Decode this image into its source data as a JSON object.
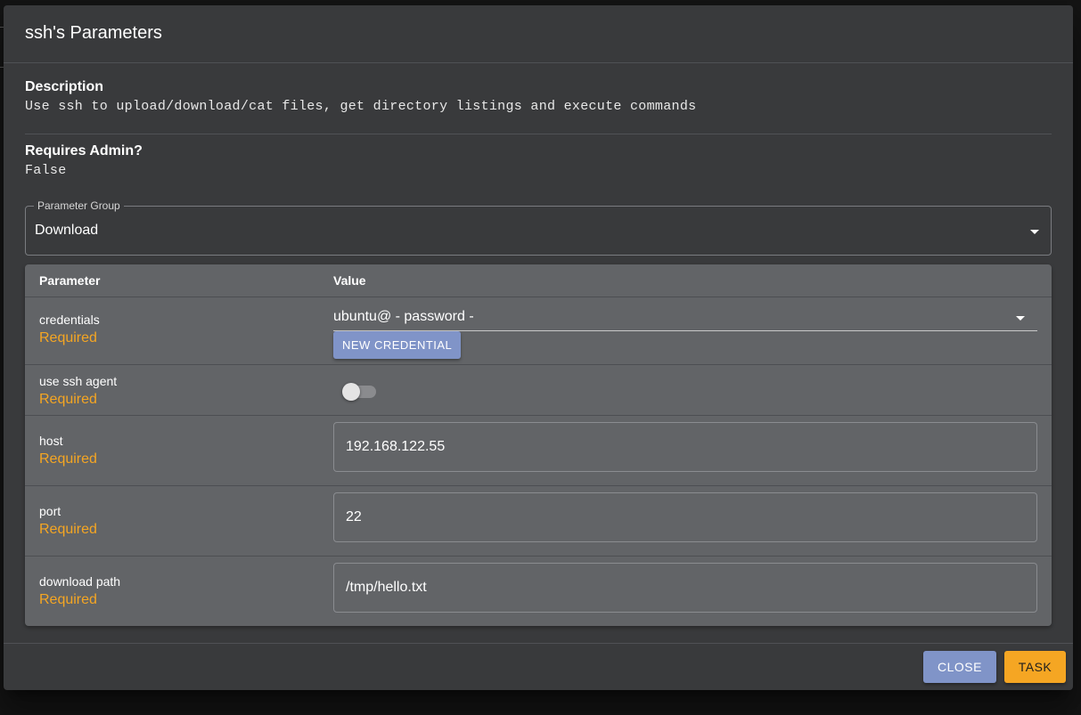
{
  "dialog": {
    "title": "ssh's Parameters",
    "description_label": "Description",
    "description": "Use ssh to upload/download/cat files, get directory listings and execute commands",
    "admin_label": "Requires Admin?",
    "admin_value": "False"
  },
  "group_select": {
    "label": "Parameter Group",
    "value": "Download"
  },
  "table": {
    "headers": {
      "parameter": "Parameter",
      "value": "Value"
    },
    "rows": [
      {
        "name": "credentials",
        "required": "Required",
        "value": "ubuntu@ - password -",
        "button": "NEW CREDENTIAL"
      },
      {
        "name": "use ssh agent",
        "required": "Required",
        "toggle_on": false
      },
      {
        "name": "host",
        "required": "Required",
        "value": "192.168.122.55"
      },
      {
        "name": "port",
        "required": "Required",
        "value": "22"
      },
      {
        "name": "download path",
        "required": "Required",
        "value": "/tmp/hello.txt"
      }
    ]
  },
  "actions": {
    "close": "CLOSE",
    "task": "TASK"
  },
  "colors": {
    "dialog_bg": "#393a3c",
    "table_bg": "#626467",
    "required": "#f5a623",
    "primary_button": "#8094c8",
    "task_button": "#f5a623"
  },
  "icons": {
    "select_caret": "chevron-down-icon"
  }
}
